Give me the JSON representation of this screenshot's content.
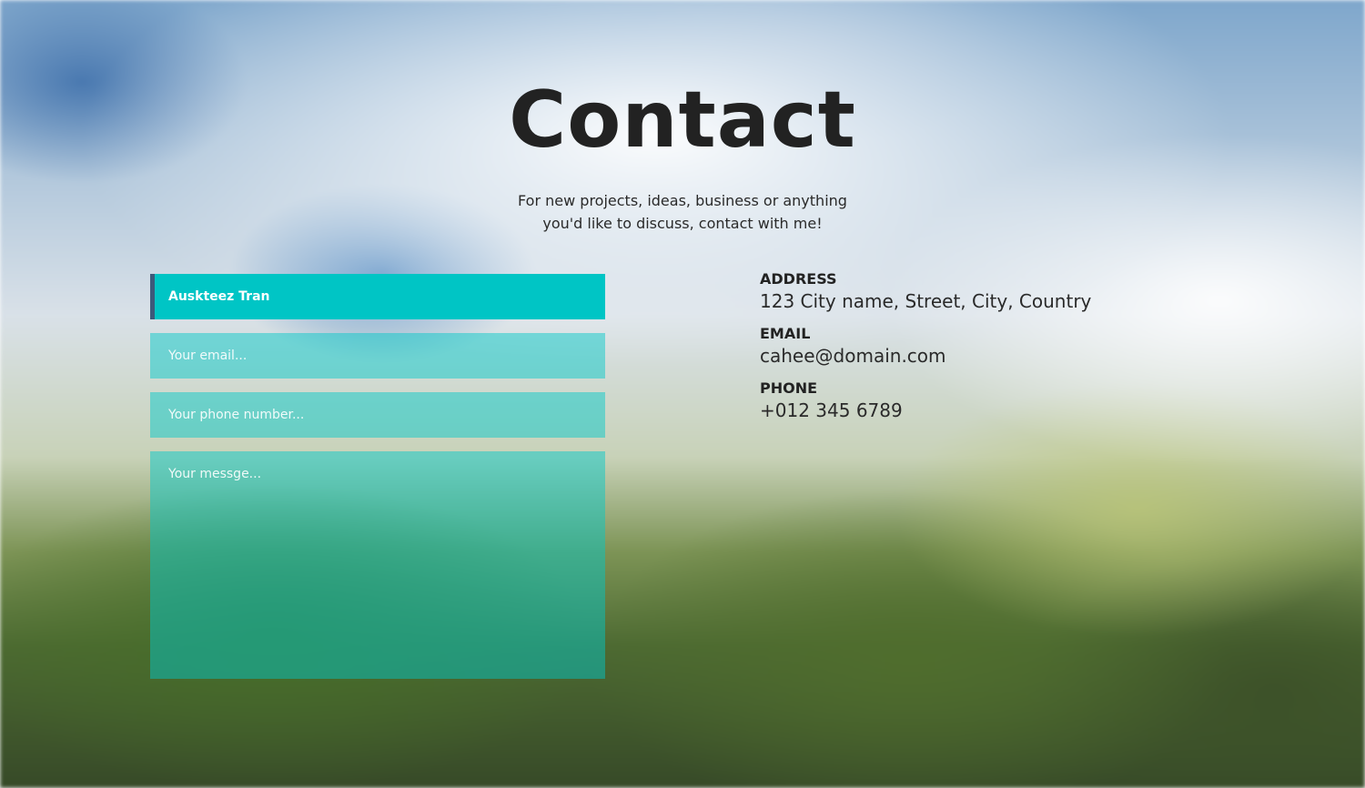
{
  "header": {
    "title": "Contact",
    "subtitle_line1": "For new projects, ideas, business or anything",
    "subtitle_line2": "you'd like to discuss, contact with me!"
  },
  "form": {
    "name_value": "Auskteez Tran",
    "email_placeholder": "Your email...",
    "phone_placeholder": "Your phone number...",
    "message_placeholder": "Your messge..."
  },
  "contact_info": {
    "address_label": "ADDRESS",
    "address_value": "123 City name, Street, City, Country",
    "email_label": "EMAIL",
    "email_value": "cahee@domain.com",
    "phone_label": "PHONE",
    "phone_value": "+012 345 6789"
  },
  "colors": {
    "field_active": "#00c5c5",
    "field_inactive": "rgba(0,200,200,0.48)",
    "field_active_border": "#3d5a7a",
    "text_dark": "#222222"
  }
}
